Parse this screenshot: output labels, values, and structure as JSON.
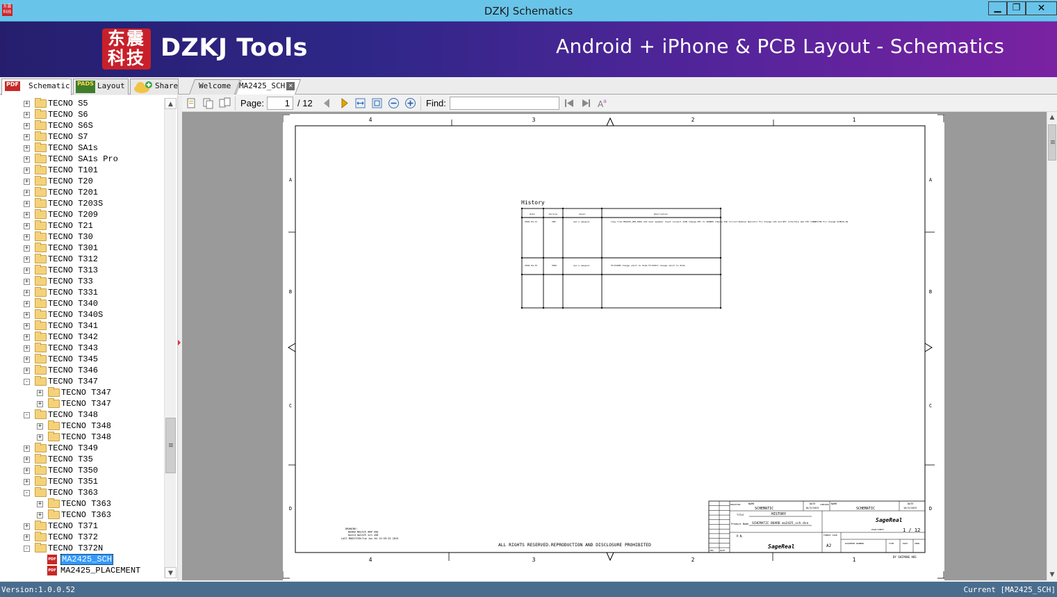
{
  "window": {
    "title": "DZKJ Schematics",
    "icon_text": "东震科技",
    "min_label": "▁",
    "max_label": "❐",
    "close_label": "✕"
  },
  "banner": {
    "logo_text": "东震科技",
    "brand": "DZKJ Tools",
    "tagline": "Android + iPhone & PCB Layout - Schematics"
  },
  "left_tabs": [
    {
      "label": "Schematic",
      "icon": "PDF"
    },
    {
      "label": "Layout",
      "icon": "PADS"
    },
    {
      "label": "Share",
      "icon": "cloud-add-icon"
    }
  ],
  "doc_tabs": [
    {
      "label": "Welcome"
    },
    {
      "label": "MA2425_SCH",
      "close": "✕"
    }
  ],
  "tree": {
    "items": [
      {
        "label": "TECNO S5",
        "level": 0,
        "exp": "+"
      },
      {
        "label": "TECNO S6",
        "level": 0,
        "exp": "+"
      },
      {
        "label": "TECNO S6S",
        "level": 0,
        "exp": "+"
      },
      {
        "label": "TECNO S7",
        "level": 0,
        "exp": "+"
      },
      {
        "label": "TECNO SA1s",
        "level": 0,
        "exp": "+"
      },
      {
        "label": "TECNO SA1s Pro",
        "level": 0,
        "exp": "+"
      },
      {
        "label": "TECNO T101",
        "level": 0,
        "exp": "+"
      },
      {
        "label": "TECNO T20",
        "level": 0,
        "exp": "+"
      },
      {
        "label": "TECNO T201",
        "level": 0,
        "exp": "+"
      },
      {
        "label": "TECNO T203S",
        "level": 0,
        "exp": "+"
      },
      {
        "label": "TECNO T209",
        "level": 0,
        "exp": "+"
      },
      {
        "label": "TECNO T21",
        "level": 0,
        "exp": "+"
      },
      {
        "label": "TECNO T30",
        "level": 0,
        "exp": "+"
      },
      {
        "label": "TECNO T301",
        "level": 0,
        "exp": "+"
      },
      {
        "label": "TECNO T312",
        "level": 0,
        "exp": "+"
      },
      {
        "label": "TECNO T313",
        "level": 0,
        "exp": "+"
      },
      {
        "label": "TECNO T33",
        "level": 0,
        "exp": "+"
      },
      {
        "label": "TECNO T331",
        "level": 0,
        "exp": "+"
      },
      {
        "label": "TECNO T340",
        "level": 0,
        "exp": "+"
      },
      {
        "label": "TECNO T340S",
        "level": 0,
        "exp": "+"
      },
      {
        "label": "TECNO T341",
        "level": 0,
        "exp": "+"
      },
      {
        "label": "TECNO T342",
        "level": 0,
        "exp": "+"
      },
      {
        "label": "TECNO T343",
        "level": 0,
        "exp": "+"
      },
      {
        "label": "TECNO T345",
        "level": 0,
        "exp": "+"
      },
      {
        "label": "TECNO T346",
        "level": 0,
        "exp": "+"
      },
      {
        "label": "TECNO T347",
        "level": 0,
        "exp": "-"
      },
      {
        "label": "TECNO T347",
        "level": 1,
        "exp": "+"
      },
      {
        "label": "TECNO T347",
        "level": 1,
        "exp": "+"
      },
      {
        "label": "TECNO T348",
        "level": 0,
        "exp": "-"
      },
      {
        "label": "TECNO T348",
        "level": 1,
        "exp": "+"
      },
      {
        "label": "TECNO T348",
        "level": 1,
        "exp": "+"
      },
      {
        "label": "TECNO T349",
        "level": 0,
        "exp": "+"
      },
      {
        "label": "TECNO T35",
        "level": 0,
        "exp": "+"
      },
      {
        "label": "TECNO T350",
        "level": 0,
        "exp": "+"
      },
      {
        "label": "TECNO T351",
        "level": 0,
        "exp": "+"
      },
      {
        "label": "TECNO T363",
        "level": 0,
        "exp": "-"
      },
      {
        "label": "TECNO T363",
        "level": 1,
        "exp": "+"
      },
      {
        "label": "TECNO T363",
        "level": 1,
        "exp": "+"
      },
      {
        "label": "TECNO T371",
        "level": 0,
        "exp": "+"
      },
      {
        "label": "TECNO T372",
        "level": 0,
        "exp": "+"
      },
      {
        "label": "TECNO T372N",
        "level": 0,
        "exp": "-"
      },
      {
        "label": "MA2425_SCH",
        "level": 1,
        "pdf": true,
        "selected": true
      },
      {
        "label": "MA2425_PLACEMENT",
        "level": 1,
        "pdf": true
      }
    ]
  },
  "toolbar": {
    "page_label": "Page:",
    "page_current": "1",
    "page_total": "/ 12",
    "find_label": "Find:",
    "find_value": ""
  },
  "schematic": {
    "top_cols": [
      "4",
      "3",
      "2",
      "1"
    ],
    "rows": [
      "A",
      "B",
      "C",
      "D"
    ],
    "history_title": "History",
    "history_headers": [
      "Date",
      "Version",
      "Owner",
      "Description"
    ],
    "history_rows": [
      [
        "2018-03-11",
        "V00",
        "qun.x.wangxun",
        "Copy from MA2425_V00_HQ24  Add dual speaker input connect J100  Change NTC to 5K6B05  Change VSD Circuit:Remove Resistor  Fix Change LCD and NFC interface  Add FPC CONNECTOR  Fix change XL8019-4Q"
      ],
      [
        "2018-04-15",
        "V001",
        "qun.x.wangxun",
        "FX:R1000 change short to 0ohm  FX:R1017 change short to 0ohm"
      ],
      [
        "",
        "",
        "",
        ""
      ]
    ],
    "drawing_lines": [
      "DRAWING:",
      "BOARD MA2425 ### V00",
      "board ma2425 sch v00",
      "LAST.MODIFIED=Tue Jun 04 13:59:33 2019"
    ],
    "rights": "ALL RIGHTS RESERVED.REPRODUCTION AND DISCLOSURE PROHIBITED",
    "tb_name1": "SCHEMATIC",
    "tb_date1": "16/3/2019",
    "tb_name2": "SCHEMATIC",
    "tb_date2": "16/3/2019",
    "tb_title": "HISTORY",
    "tb_product": "SCHEMATIC BOARD ma2425_sch.dsn",
    "tb_format": "A2",
    "tb_sheet": "1 / 12",
    "tb_labels": {
      "modified": "MODIFIED",
      "name": "NAME",
      "date": "DATE",
      "checked": "CHECKED",
      "title": "TITLE",
      "product": "Product Name",
      "pn": "P.N.",
      "format": "FORMAT SIZE",
      "docnum": "DOCUMENT NUMBER",
      "type": "TYPE",
      "part": "PART",
      "verd": "VERD.",
      "page": "PAGE/SHEET",
      "ver": "VER.",
      "datec": "DATE"
    },
    "brand": "SageReal",
    "footer": "BY SHIPANG HOS"
  },
  "status": {
    "version": "Version:1.0.0.52",
    "current": "Current [MA2425_SCH]"
  }
}
